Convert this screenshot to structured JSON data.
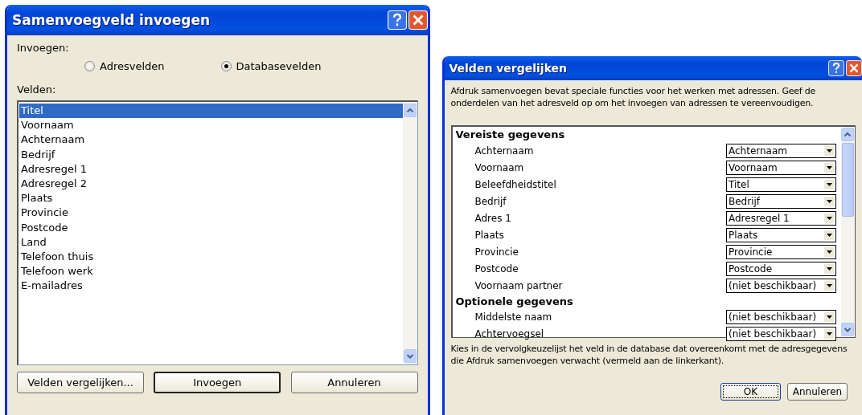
{
  "insert_dialog": {
    "title": "Samenvoegveld invoegen",
    "insert_label": "Invoegen:",
    "options": [
      {
        "label": "Adresvelden",
        "selected": false
      },
      {
        "label": "Databasevelden",
        "selected": true
      }
    ],
    "fields_label": "Velden:",
    "fields": [
      {
        "label": "Titel",
        "selected": true
      },
      {
        "label": "Voornaam",
        "selected": false
      },
      {
        "label": "Achternaam",
        "selected": false
      },
      {
        "label": "Bedrijf",
        "selected": false
      },
      {
        "label": "Adresregel 1",
        "selected": false
      },
      {
        "label": "Adresregel 2",
        "selected": false
      },
      {
        "label": "Plaats",
        "selected": false
      },
      {
        "label": "Provincie",
        "selected": false
      },
      {
        "label": "Postcode",
        "selected": false
      },
      {
        "label": "Land",
        "selected": false
      },
      {
        "label": "Telefoon thuis",
        "selected": false
      },
      {
        "label": "Telefoon werk",
        "selected": false
      },
      {
        "label": "E-mailadres",
        "selected": false
      }
    ],
    "buttons": [
      {
        "label": "Velden vergelijken...",
        "default": false
      },
      {
        "label": "Invoegen",
        "default": true
      },
      {
        "label": "Annuleren",
        "default": false
      }
    ]
  },
  "match_dialog": {
    "title": "Velden vergelijken",
    "intro": "Afdruk samenvoegen bevat speciale functies voor het werken met adressen. Geef de onderdelen van het adresveld op om het invoegen van adressen te vereenvoudigen.",
    "groups": [
      {
        "heading": "Vereiste gegevens",
        "rows": [
          {
            "label": "Achternaam",
            "value": "Achternaam"
          },
          {
            "label": "Voornaam",
            "value": "Voornaam"
          },
          {
            "label": "Beleefdheidstitel",
            "value": "Titel"
          },
          {
            "label": "Bedrijf",
            "value": "Bedrijf"
          },
          {
            "label": "Adres 1",
            "value": "Adresregel 1"
          },
          {
            "label": "Plaats",
            "value": "Plaats"
          },
          {
            "label": "Provincie",
            "value": "Provincie"
          },
          {
            "label": "Postcode",
            "value": "Postcode"
          },
          {
            "label": "Voornaam partner",
            "value": "(niet beschikbaar)"
          }
        ]
      },
      {
        "heading": "Optionele gegevens",
        "rows": [
          {
            "label": "Middelste naam",
            "value": "(niet beschikbaar)"
          },
          {
            "label": "Achtervoegsel",
            "value": "(niet beschikbaar)"
          }
        ]
      }
    ],
    "hint": "Kies in de vervolgkeuzelijst het veld in de database dat overeenkomt met de adresgegevens die Afdruk samenvoegen verwacht (vermeld aan de linkerkant).",
    "buttons": [
      {
        "label": "OK",
        "default": true
      },
      {
        "label": "Annuleren",
        "default": false
      }
    ]
  }
}
